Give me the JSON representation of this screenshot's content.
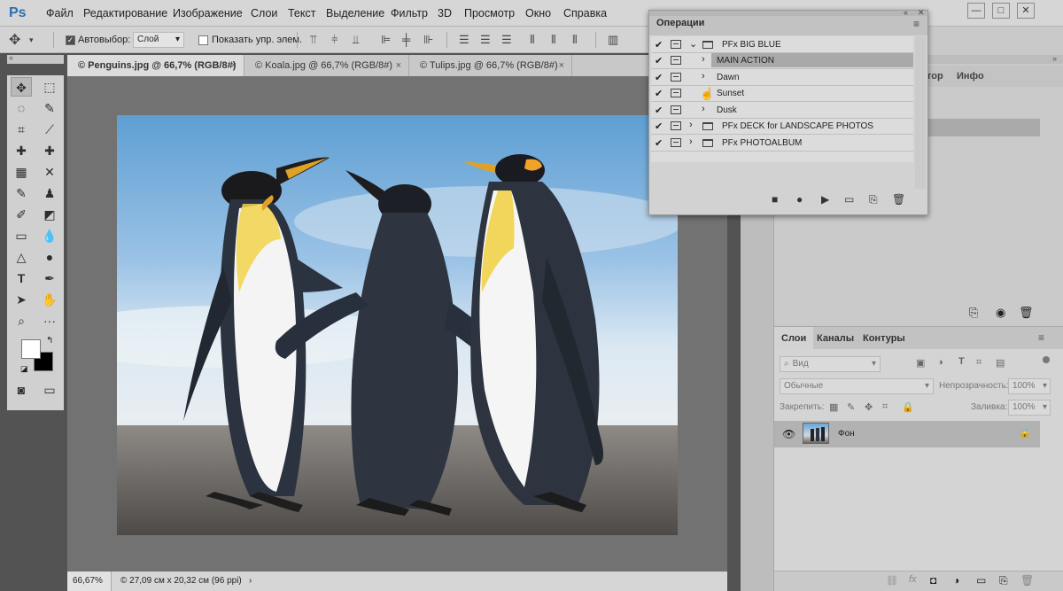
{
  "app": {
    "logo": "Ps"
  },
  "menu": [
    "Файл",
    "Редактирование",
    "Изображение",
    "Слои",
    "Текст",
    "Выделение",
    "Фильтр",
    "3D",
    "Просмотр",
    "Окно",
    "Справка"
  ],
  "window_controls": {
    "minimize": "—",
    "maximize": "□",
    "close": "✕"
  },
  "options": {
    "autoselect_label": "Автовыбор:",
    "layer_dropdown": "Слой",
    "show_transform_label": "Показать упр. элем."
  },
  "tabs": [
    {
      "label": "© Penguins.jpg @ 66,7% (RGB/8#)",
      "close": "×"
    },
    {
      "label": "© Koala.jpg @ 66,7% (RGB/8#)",
      "close": "×"
    },
    {
      "label": "© Tulips.jpg @ 66,7% (RGB/8#)",
      "close": "×"
    }
  ],
  "status": {
    "zoom": "66,67%",
    "info": "© 27,09 см x 20,32 см (96 ppi)"
  },
  "actions_panel": {
    "title": "Операции",
    "rows": [
      {
        "label": "PFx BIG BLUE",
        "type": "set",
        "expanded": true
      },
      {
        "label": "MAIN ACTION",
        "type": "action",
        "selected": true
      },
      {
        "label": "Dawn",
        "type": "action"
      },
      {
        "label": "Sunset",
        "type": "action"
      },
      {
        "label": "Dusk",
        "type": "action"
      },
      {
        "label": "PFx DECK for LANDSCAPE PHOTOS",
        "type": "set"
      },
      {
        "label": "PFx PHOTOALBUM",
        "type": "set"
      }
    ],
    "check": "✔"
  },
  "nav_tabs": [
    "тор",
    "Инфо"
  ],
  "layers_panel": {
    "tabs": [
      "Слои",
      "Каналы",
      "Контуры"
    ],
    "kind_filter": "Вид",
    "blend_mode": "Обычные",
    "opacity_label": "Непрозрачность:",
    "opacity_value": "100%",
    "lock_label": "Закрепить:",
    "fill_label": "Заливка:",
    "fill_value": "100%",
    "layer_name": "Фон"
  },
  "colors": {
    "accent": "#2f6fb4",
    "canvas_bg": "#727272",
    "panel_bg": "#d4d4d4"
  }
}
